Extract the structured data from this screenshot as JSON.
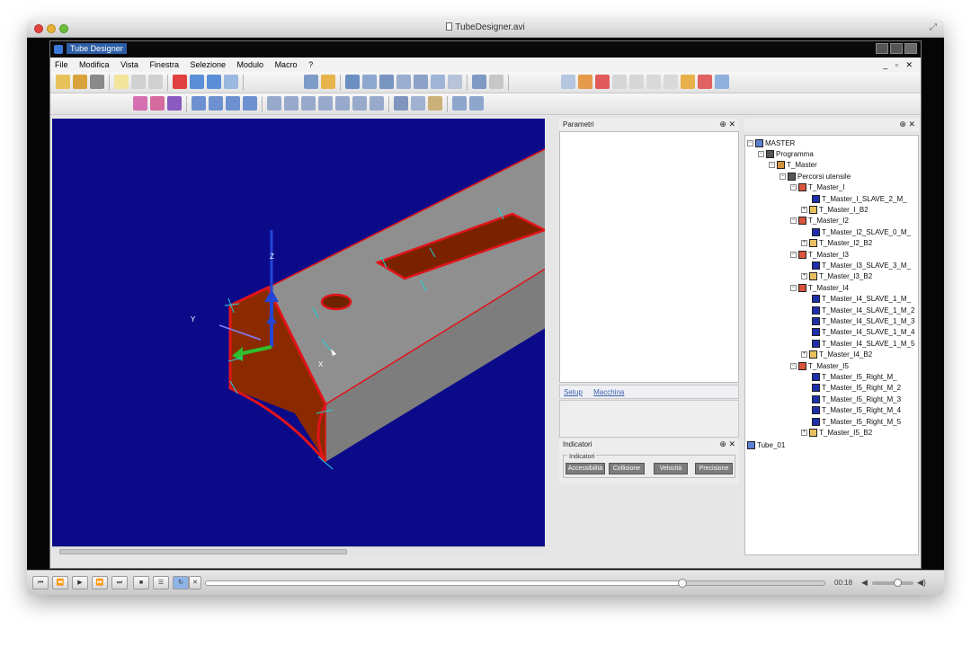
{
  "mac_window": {
    "title": "TubeDesigner.avi",
    "doc_icon": "document-icon"
  },
  "app": {
    "title": "Tube Designer",
    "menu": [
      "File",
      "Modifica",
      "Vista",
      "Finestra",
      "Selezione",
      "Modulo",
      "Macro",
      "?"
    ],
    "window_controls_right": "_ ▫ ✕"
  },
  "viewport": {
    "background": "#0b0b8a",
    "axis_labels": {
      "z": "Z",
      "y": "Y",
      "x": "X"
    }
  },
  "panels": {
    "parametri": {
      "title": "Parametri",
      "tabs": [
        "Setup",
        "Macchina"
      ]
    },
    "indicatori": {
      "title": "Indicatori",
      "group_label": "Indicatori",
      "buttons": [
        "Accessibilità",
        "Collisione",
        "Velocità",
        "Precisione"
      ]
    }
  },
  "tree": {
    "root": "MASTER",
    "programma": "Programma",
    "t_master": "T_Master",
    "percorsi": "Percorsi utensile",
    "groups": [
      {
        "name": "T_Master_I",
        "children": [
          "T_Master_I_SLAVE_2_M_",
          "T_Master_I_B2"
        ]
      },
      {
        "name": "T_Master_I2",
        "children": [
          "T_Master_I2_SLAVE_0_M_",
          "T_Master_I2_B2"
        ]
      },
      {
        "name": "T_Master_I3",
        "children": [
          "T_Master_I3_SLAVE_3_M_",
          "T_Master_I3_B2"
        ]
      },
      {
        "name": "T_Master_I4",
        "children": [
          "T_Master_I4_SLAVE_1_M_",
          "T_Master_I4_SLAVE_1_M_2",
          "T_Master_I4_SLAVE_1_M_3",
          "T_Master_I4_SLAVE_1_M_4",
          "T_Master_I4_SLAVE_1_M_5",
          "T_Master_I4_B2"
        ]
      },
      {
        "name": "T_Master_I5",
        "children": [
          "T_Master_I5_Right_M_",
          "T_Master_I5_Right_M_2",
          "T_Master_I5_Right_M_3",
          "T_Master_I5_Right_M_4",
          "T_Master_I5_Right_M_5",
          "T_Master_I5_B2"
        ]
      }
    ],
    "tube": "Tube_01"
  },
  "player": {
    "time": "00:18",
    "progress": 0.77,
    "volume": 0.6
  },
  "colors": {
    "accent_red": "#e0141a",
    "part_brown": "#8b2a00",
    "part_gray": "#9a9a9a",
    "axis_blue": "#2346d6",
    "axis_green": "#2fbf2f",
    "edge_cyan": "#1fd4e0"
  }
}
